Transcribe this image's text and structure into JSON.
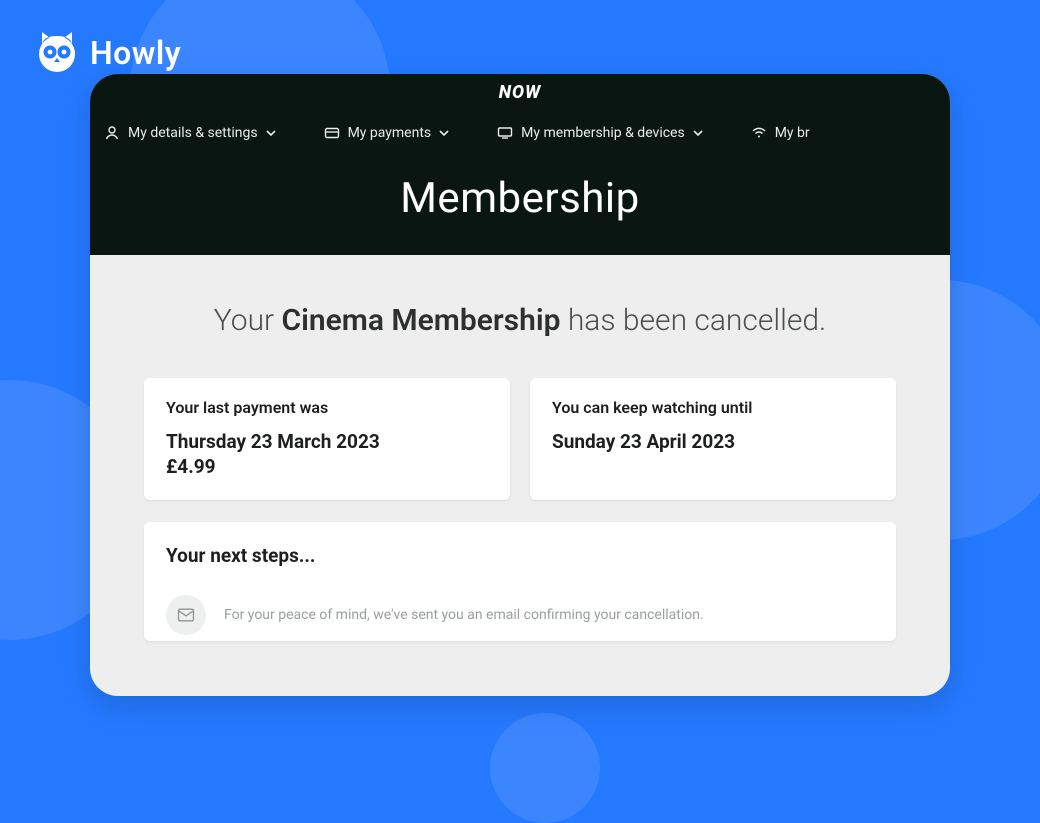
{
  "logo": {
    "brand": "Howly"
  },
  "app": {
    "brand": "NOW",
    "nav": [
      {
        "label": "My details & settings"
      },
      {
        "label": "My payments"
      },
      {
        "label": "My membership & devices"
      },
      {
        "label": "My br"
      }
    ],
    "page_title": "Membership",
    "headline_prefix": "Your ",
    "headline_bold": "Cinema Membership",
    "headline_suffix": " has been cancelled.",
    "last_payment": {
      "label": "Your last payment was",
      "date": "Thursday 23 March 2023",
      "amount": "£4.99"
    },
    "watch_until": {
      "label": "You can keep watching until",
      "date": "Sunday 23 April 2023"
    },
    "next_steps": {
      "title": "Your next steps...",
      "email_text": "For your peace of mind, we've sent you an email confirming your cancellation."
    }
  }
}
